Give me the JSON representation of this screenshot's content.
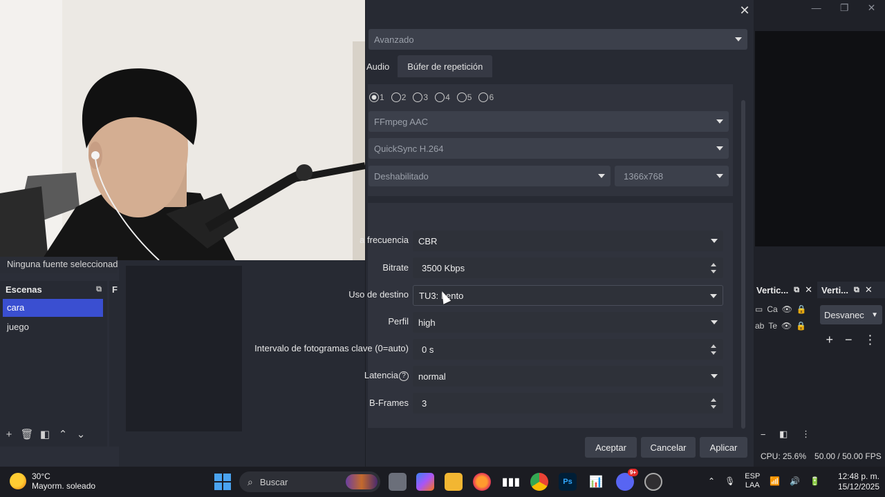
{
  "dialog": {
    "mode_select": "Avanzado",
    "tabs": [
      {
        "label": "Audio"
      },
      {
        "label": "Búfer de repetición"
      }
    ],
    "audio_tracks": [
      "1",
      "2",
      "3",
      "4",
      "5",
      "6"
    ],
    "audio_encoder": "FFmpeg AAC",
    "video_encoder": "QuickSync H.264",
    "rescale_mode": "Deshabilitado",
    "rescale_resolution": "1366x768",
    "fields": {
      "rate_control": {
        "label": "a frecuencia",
        "value": "CBR"
      },
      "bitrate": {
        "label": "Bitrate",
        "value": "3500 Kbps"
      },
      "target_usage": {
        "label": "Uso de destino",
        "value": "TU3: Lento"
      },
      "profile": {
        "label": "Perfil",
        "value": "high"
      },
      "keyframe_interval": {
        "label": "Intervalo de fotogramas clave (0=auto)",
        "value": "0 s"
      },
      "latency": {
        "label": "Latencia",
        "value": "normal",
        "help_icon": "?"
      },
      "bframes": {
        "label": "B-Frames",
        "value": "3"
      }
    },
    "buttons": {
      "accept": "Aceptar",
      "cancel": "Cancelar",
      "apply": "Aplicar"
    },
    "close_glyph": "✕"
  },
  "obs": {
    "no_source": "Ninguna fuente seleccionad",
    "scenes": {
      "title": "Escenas",
      "items": [
        {
          "label": "cara"
        },
        {
          "label": "juego"
        }
      ]
    },
    "sources_stub": "F",
    "dock_a": {
      "title": "Vertic...",
      "sources": [
        {
          "label": "Ca"
        },
        {
          "label": "Te"
        }
      ]
    },
    "dock_b": {
      "title": "Verti...",
      "transition": "Desvanec"
    },
    "status": {
      "cpu": "CPU: 25.6%",
      "fps": "50.00 / 50.00 FPS"
    }
  },
  "taskbar": {
    "weather": {
      "temp": "30°C",
      "desc": "Mayorm. soleado"
    },
    "search_placeholder": "Buscar",
    "apps": [
      "file-explorer",
      "copilot",
      "folder",
      "firefox",
      "audio-app",
      "chrome",
      "photoshop",
      "stats-app",
      "discord",
      "obs"
    ],
    "photoshop_label": "Ps",
    "discord_badge": "9+",
    "lang": {
      "line1": "ESP",
      "line2": "LAA"
    },
    "clock": {
      "time": "12:48 p. m.",
      "date": "15/12/2025"
    }
  },
  "colors": {
    "accent_scene": "#3a4fd1",
    "dialog_bg": "#272a33",
    "select_bg": "#3c404b",
    "taskbar_bg": "#1b1c22"
  }
}
